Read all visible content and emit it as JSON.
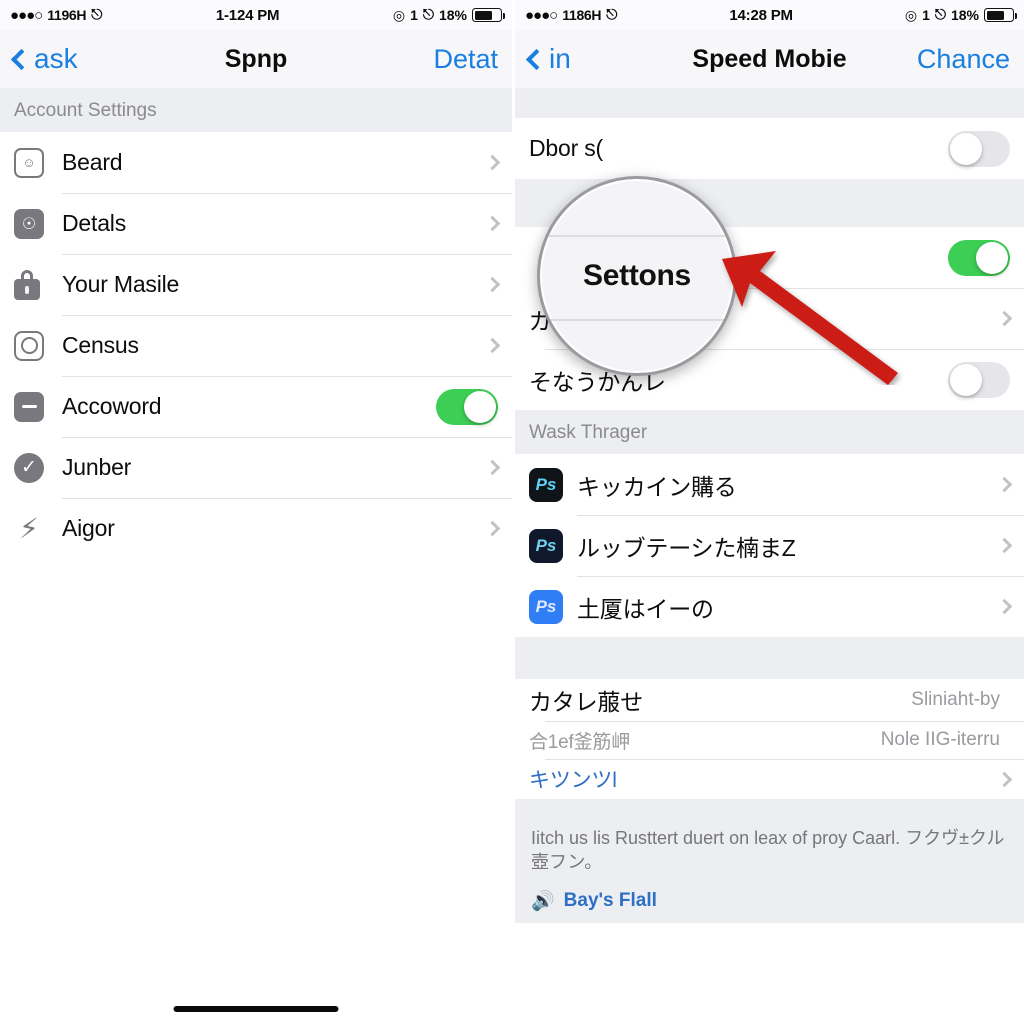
{
  "left_panel": {
    "status_bar": {
      "signal_dots": "●●●○",
      "carrier": "1196H",
      "wifi_icon": "wifi-icon",
      "time": "1-124 PM",
      "alarm_icon": "target-icon",
      "badge": "1",
      "wifi_icon_right": "wifi-icon",
      "battery_percent": "18%",
      "battery_icon": "battery-icon"
    },
    "nav": {
      "back_label": "ask",
      "back_icon": "chevron-left-icon",
      "title": "Spnp",
      "action_label": "Detat"
    },
    "section_header": "Account Settings",
    "rows": [
      {
        "icon": "face-id-icon",
        "label": "Beard",
        "accessory": "chevron"
      },
      {
        "icon": "contact-icon",
        "label": "Detals",
        "accessory": "chevron"
      },
      {
        "icon": "lock-icon",
        "label": "Your Masile",
        "accessory": "chevron"
      },
      {
        "icon": "circle-icon",
        "label": "Census",
        "accessory": "chevron"
      },
      {
        "icon": "minus-card-icon",
        "label": "Accoword",
        "accessory": "toggle",
        "toggle_on": true
      },
      {
        "icon": "check-icon",
        "label": "Junber",
        "accessory": "chevron"
      },
      {
        "icon": "bolt-icon",
        "label": "Aigor",
        "accessory": "chevron"
      }
    ]
  },
  "right_panel": {
    "status_bar": {
      "signal_dots": "●●●○",
      "carrier": "1186H",
      "wifi_icon": "wifi-icon",
      "time": "14:28 PM",
      "alarm_icon": "target-icon",
      "badge": "1",
      "wifi_icon_right": "wifi-icon",
      "battery_percent": "18%",
      "battery_icon": "battery-icon"
    },
    "nav": {
      "back_label": "in",
      "back_icon": "chevron-left-icon",
      "title": "Speed Mobie",
      "action_label": "Chance"
    },
    "rows_top": [
      {
        "label": "Dbor s(",
        "accessory": "toggle",
        "toggle_on": false
      },
      {
        "label": "",
        "accessory": "toggle",
        "toggle_on": true
      },
      {
        "label": "ガラ    ble",
        "accessory": "chevron"
      },
      {
        "label": "そなうかんレ",
        "accessory": "toggle",
        "toggle_on": false
      }
    ],
    "section_header": "Wask Thrager",
    "app_rows": [
      {
        "icon": "photoshop-icon",
        "icon_color": "#0f1419",
        "label": "キッカイン購る",
        "accessory": "chevron"
      },
      {
        "icon": "photoshop-icon",
        "icon_color": "#10182b",
        "label": "ルッブテーシた楠まZ",
        "accessory": "chevron"
      },
      {
        "icon": "photoshop-icon",
        "icon_color": "#2f7ef5",
        "label": "土厦はイーの",
        "accessory": "chevron"
      }
    ],
    "detail_rows": [
      {
        "label": "カタレ菔せ",
        "value": "Sliniaht-by"
      },
      {
        "label": "合1ef釜筋岬",
        "value": "Nole IIG-iterru"
      },
      {
        "label": "キツンツl",
        "accessory": "chevron",
        "link": true
      }
    ],
    "footer": {
      "text": "Iitch us lis Rusttert duert on leax of proy Caarl. フクヴ±クル壺フン。",
      "link_label": "Bay's Flall",
      "link_icon": "speaker-icon"
    }
  },
  "annotation": {
    "magnifier_text": "Settons",
    "arrow_color": "#cc1a16",
    "magnifier_label": "magnifier-callout"
  },
  "colors": {
    "accent_blue": "#1a7fe0",
    "toggle_green": "#3cce55",
    "group_bg": "#eceef2",
    "separator": "#e2e2e5"
  }
}
